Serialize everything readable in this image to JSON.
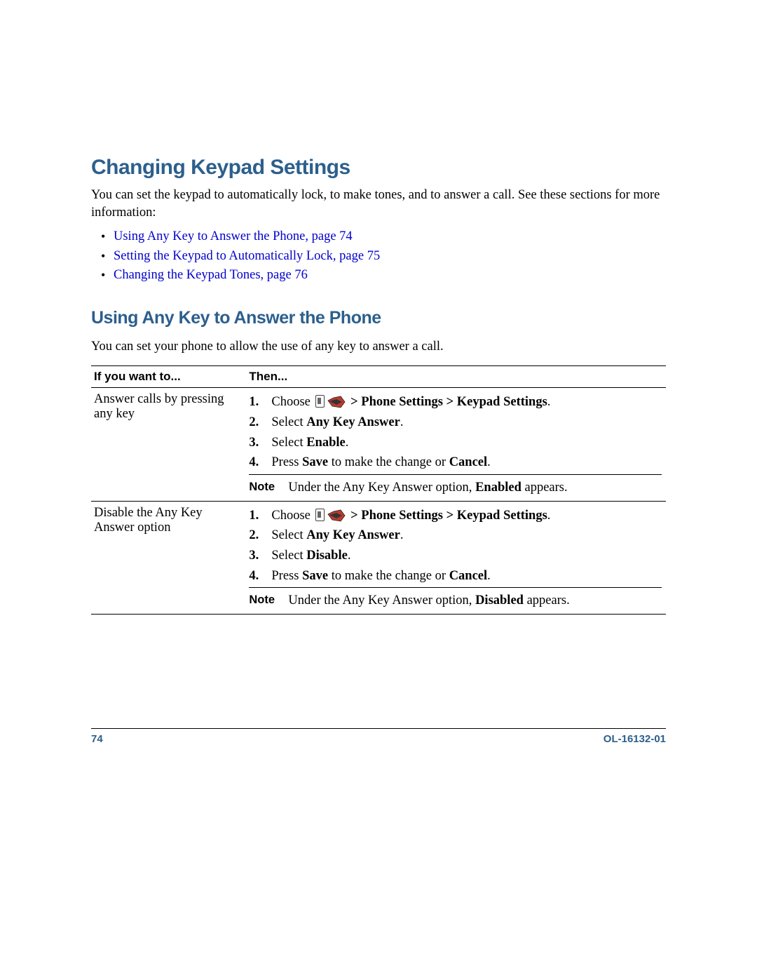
{
  "heading1": "Changing Keypad Settings",
  "intro": "You can set the keypad to automatically lock, to make tones, and to answer a call. See these sections for more information:",
  "links": [
    "Using Any Key to Answer the Phone, page 74",
    "Setting the Keypad to Automatically Lock, page 75",
    "Changing the Keypad Tones, page 76"
  ],
  "heading2": "Using Any Key to Answer the Phone",
  "subintro": "You can set your phone to allow the use of any key to answer a call.",
  "table": {
    "header": {
      "col1": "If you want to...",
      "col2": "Then..."
    },
    "rows": [
      {
        "want": "Answer calls by pressing any key",
        "steps": [
          {
            "n": "1.",
            "prefix": "Choose ",
            "icons": true,
            "suffix_bold": " > Phone Settings > Keypad Settings",
            "suffix_plain": "."
          },
          {
            "n": "2.",
            "prefix": "Select ",
            "bold": "Any Key Answer",
            "suffix_plain": "."
          },
          {
            "n": "3.",
            "prefix": "Select ",
            "bold": "Enable",
            "suffix_plain": "."
          },
          {
            "n": "4.",
            "prefix": "Press ",
            "bold": "Save",
            "mid": " to make the change or ",
            "bold2": "Cancel",
            "suffix_plain": "."
          }
        ],
        "note_label": "Note",
        "note_pre": "Under the Any Key Answer option, ",
        "note_bold": "Enabled",
        "note_post": " appears."
      },
      {
        "want": "Disable the Any Key Answer option",
        "steps": [
          {
            "n": "1.",
            "prefix": "Choose ",
            "icons": true,
            "suffix_bold": " > Phone Settings > Keypad Settings",
            "suffix_plain": "."
          },
          {
            "n": "2.",
            "prefix": "Select ",
            "bold": "Any Key Answer",
            "suffix_plain": "."
          },
          {
            "n": "3.",
            "prefix": "Select ",
            "bold": "Disable",
            "suffix_plain": "."
          },
          {
            "n": "4.",
            "prefix": "Press ",
            "bold": "Save",
            "mid": " to make the change or ",
            "bold2": "Cancel",
            "suffix_plain": "."
          }
        ],
        "note_label": "Note",
        "note_pre": "Under the Any Key Answer option, ",
        "note_bold": "Disabled",
        "note_post": " appears."
      }
    ]
  },
  "footer": {
    "page_num": "74",
    "doc_id": "OL-16132-01"
  }
}
